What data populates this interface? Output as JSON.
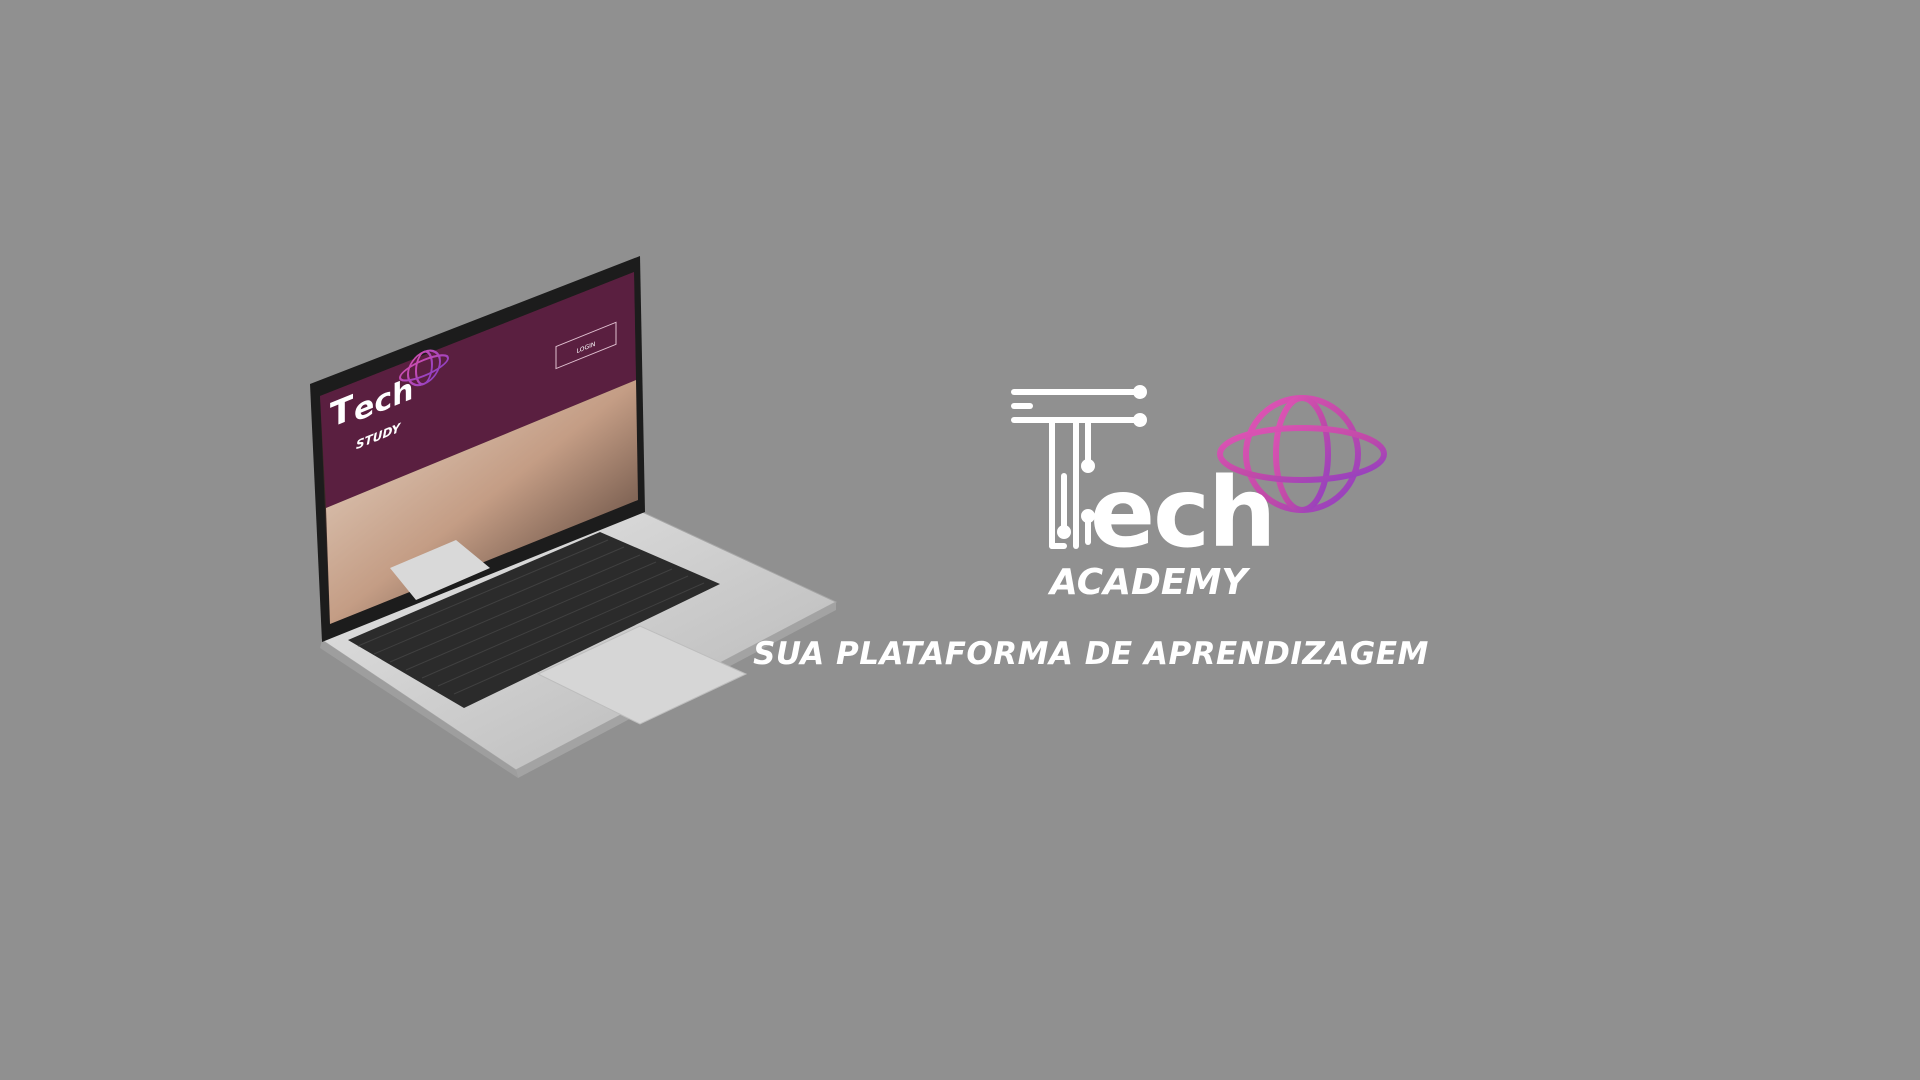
{
  "laptop_screen": {
    "brand_word": "ech",
    "brand_sub": "STUDY",
    "login_label": "LOGIN"
  },
  "logo": {
    "word": "ech",
    "subtitle": "ACADEMY"
  },
  "tagline": "SUA PLATAFORMA DE APRENDIZAGEM",
  "colors": {
    "background": "#909090",
    "screen_header": "#5a1f40",
    "accent_pink": "#c04aa8",
    "accent_purple": "#8b3fc4",
    "laptop_silver": "#c8c8c8",
    "text": "#ffffff"
  }
}
